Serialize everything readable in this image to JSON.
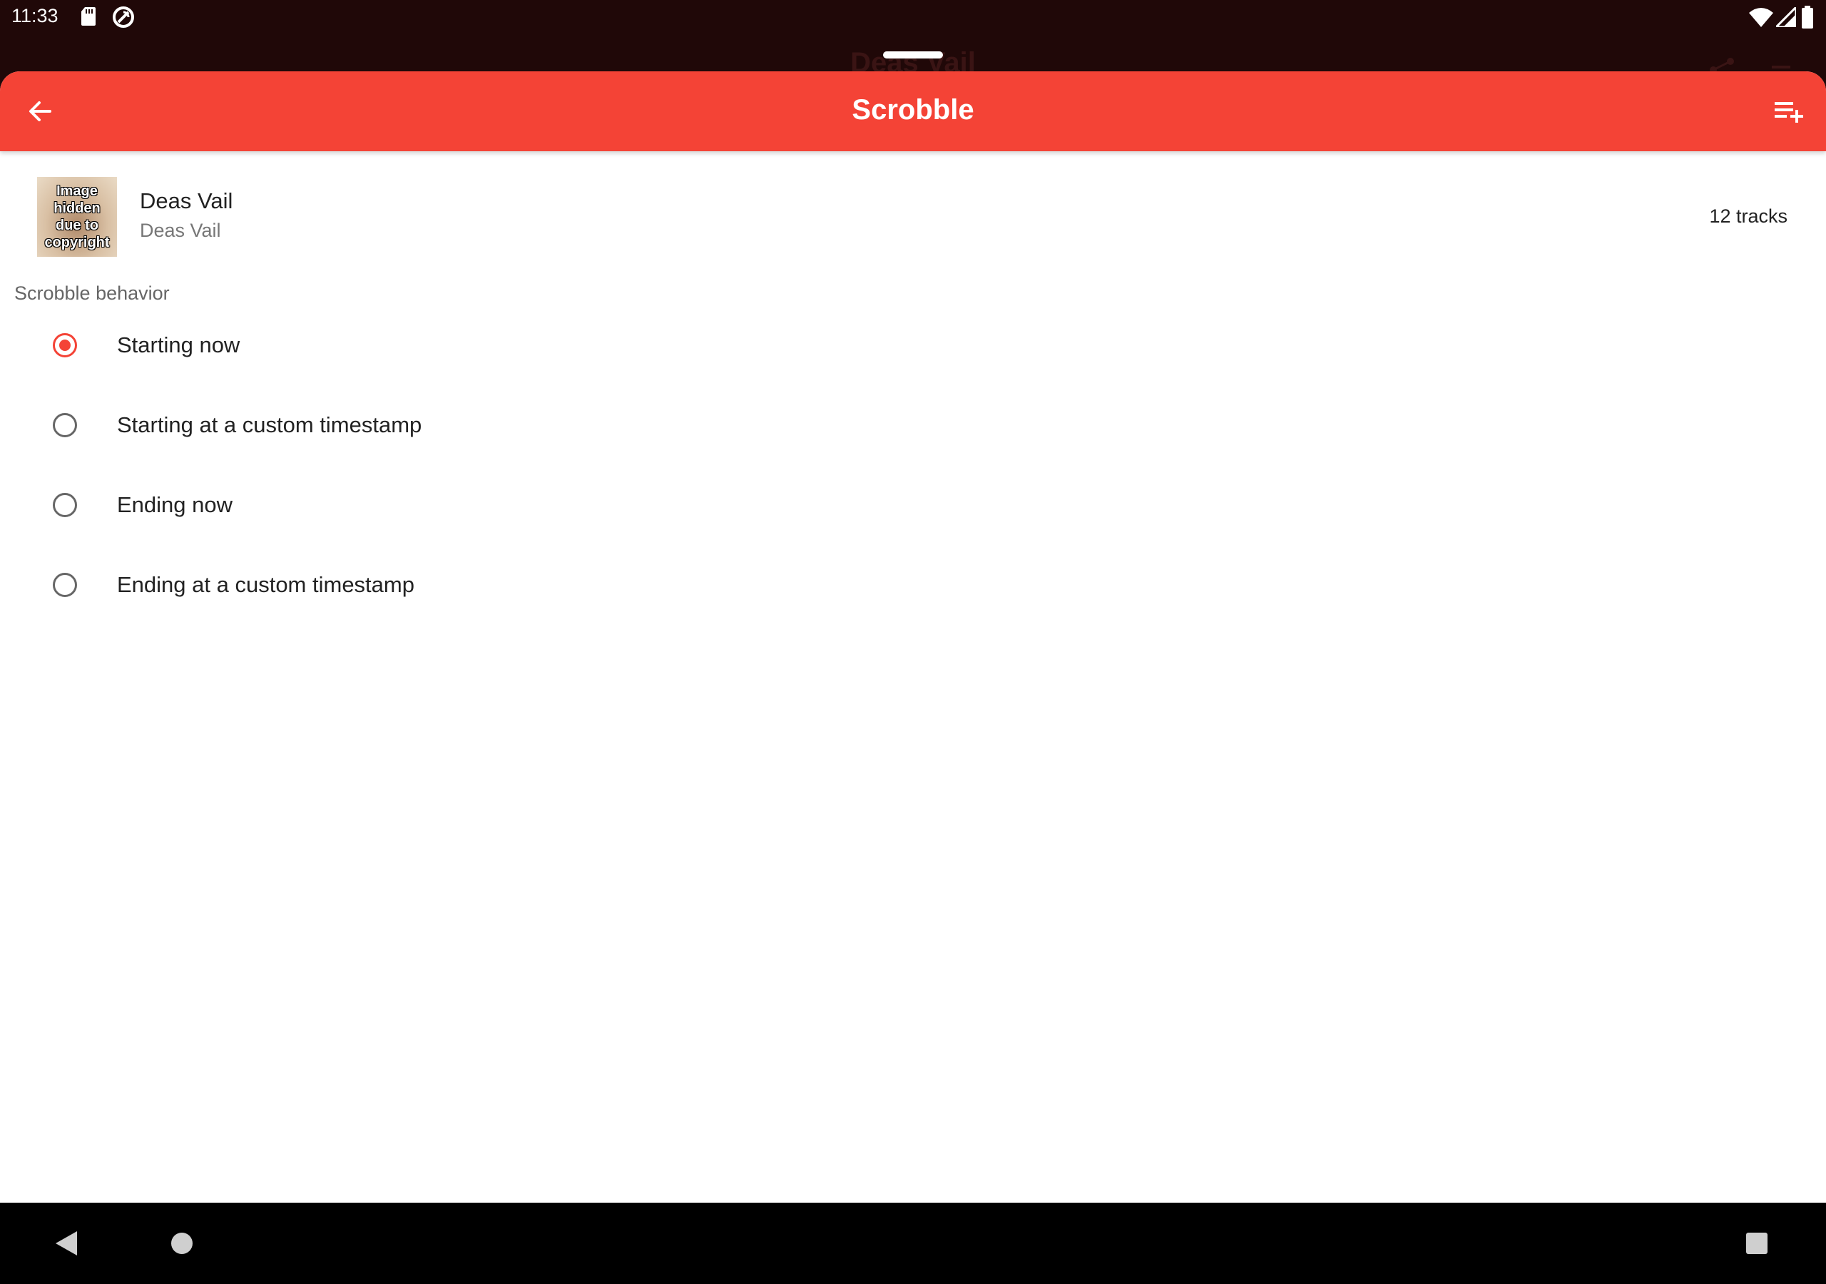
{
  "status_bar": {
    "time": "11:33",
    "icons": [
      "sd-card-icon",
      "sync-icon",
      "wifi-icon",
      "signal-icon",
      "battery-icon"
    ]
  },
  "background": {
    "title": "Deas Vail"
  },
  "app_bar": {
    "title": "Scrobble",
    "color": "#f44336",
    "back_icon": "arrow-back-icon",
    "action_icon": "playlist-add-icon"
  },
  "album": {
    "art_text": [
      "Image",
      "hidden",
      "due to",
      "copyright"
    ],
    "title": "Deas Vail",
    "artist": "Deas Vail",
    "track_count": "12 tracks"
  },
  "scrobble_behavior": {
    "label": "Scrobble behavior",
    "options": [
      {
        "label": "Starting now",
        "selected": true
      },
      {
        "label": "Starting at a custom timestamp",
        "selected": false
      },
      {
        "label": "Ending now",
        "selected": false
      },
      {
        "label": "Ending at a custom timestamp",
        "selected": false
      }
    ]
  },
  "nav_bar": {
    "icons": [
      "nav-back-icon",
      "nav-home-icon",
      "nav-recents-icon"
    ]
  }
}
